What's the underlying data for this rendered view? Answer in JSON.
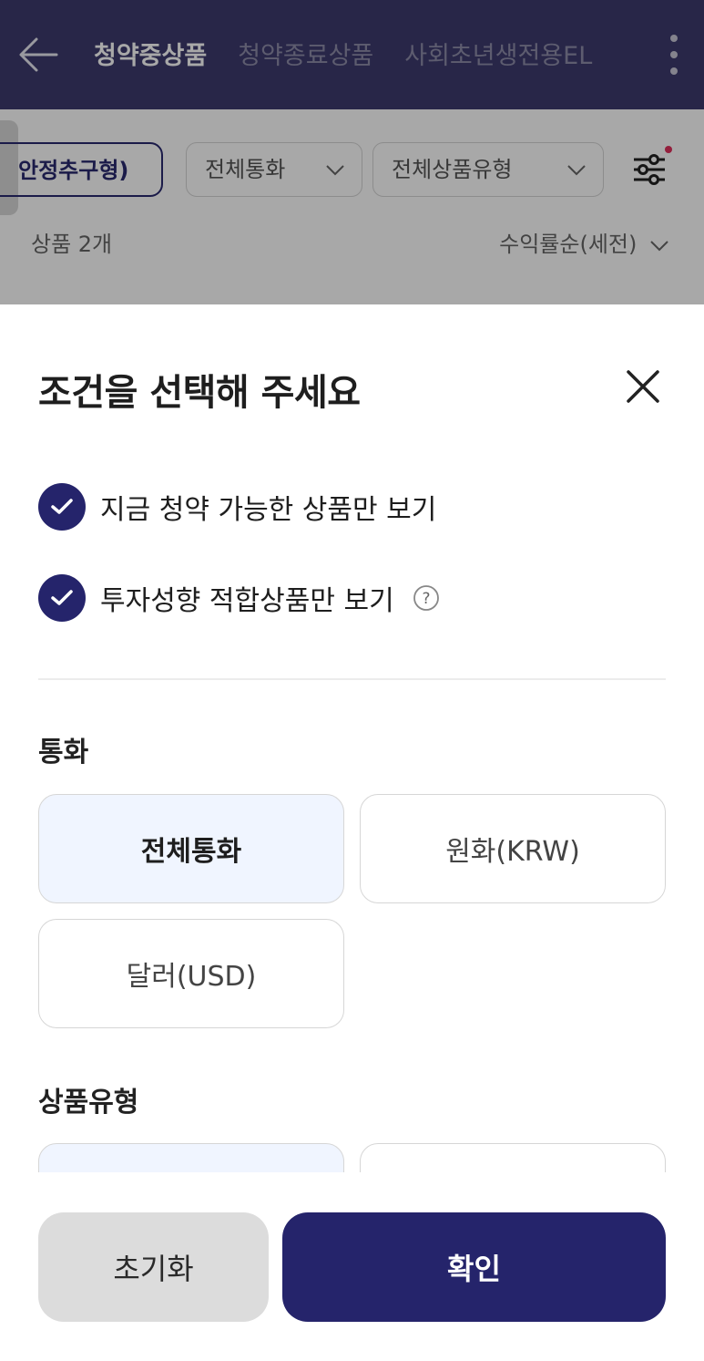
{
  "header": {
    "tabs": [
      {
        "label": "청약중상품",
        "active": true
      },
      {
        "label": "청약종료상품",
        "active": false
      },
      {
        "label": "사회초년생전용EL",
        "active": false
      }
    ]
  },
  "filters": {
    "chips": [
      "안정추구형)",
      "전체통화",
      "전체상품유형"
    ],
    "product_count": "상품 2개",
    "sort_label": "수익률순(세전)"
  },
  "sheet": {
    "title": "조건을 선택해 주세요",
    "checks": [
      {
        "label": "지금 청약 가능한 상품만 보기",
        "checked": true
      },
      {
        "label": "투자성향 적합상품만 보기",
        "checked": true
      }
    ],
    "currency": {
      "title": "통화",
      "options": [
        "전체통화",
        "원화(KRW)",
        "달러(USD)"
      ],
      "selected": "전체통화"
    },
    "product_type": {
      "title": "상품유형"
    },
    "buttons": {
      "reset": "초기화",
      "confirm": "확인"
    }
  },
  "colors": {
    "header_bg": "#3d3b6e",
    "accent_navy": "#25246b",
    "selected_option_bg": "#f0f5ff",
    "notification_dot": "#e0305b"
  }
}
